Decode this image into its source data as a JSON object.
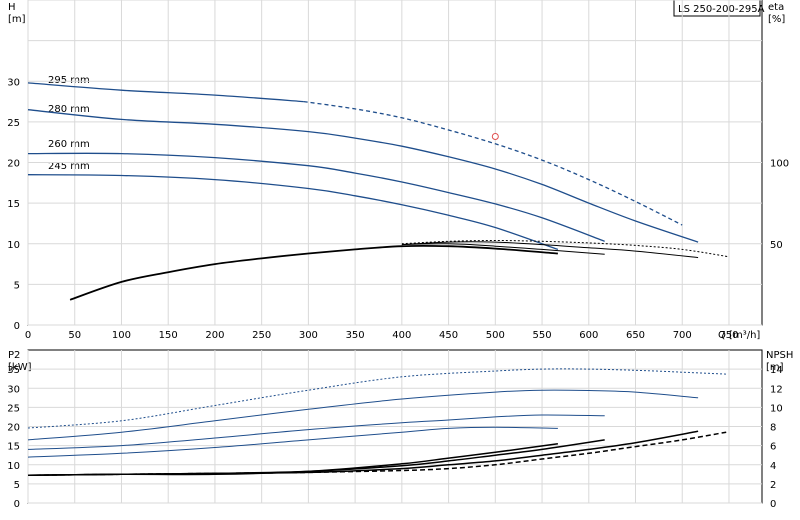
{
  "chart_data": [
    {
      "type": "line",
      "panel": "head-efficiency",
      "title": "LS 250-200-295A",
      "xlabel": "Q [m³/h]",
      "ylabel_left": {
        "name": "H",
        "unit": "[m]"
      },
      "ylabel_right": {
        "name": "eta",
        "unit": "[%]"
      },
      "xlim": [
        0,
        750
      ],
      "ylim": [
        0,
        40
      ],
      "y2lim": [
        0,
        200
      ],
      "grid": true,
      "x_ticks": [
        "0",
        "50",
        "100",
        "150",
        "200",
        "250",
        "300",
        "350",
        "400",
        "450",
        "500",
        "550",
        "600",
        "650",
        "700",
        "750"
      ],
      "y_ticks": [
        "0",
        "5",
        "10",
        "15",
        "20",
        "25",
        "30"
      ],
      "y2_ticks": [
        "50",
        "100"
      ],
      "head_series": [
        {
          "name": "295 mm",
          "color": "#1f4e8c",
          "dashed_from": 295,
          "x": [
            0,
            100,
            200,
            295,
            350,
            400,
            450,
            500,
            550,
            600,
            650,
            700
          ],
          "y": [
            29.8,
            28.9,
            28.3,
            27.5,
            26.6,
            25.5,
            24.0,
            22.3,
            20.3,
            17.9,
            15.2,
            12.3
          ]
        },
        {
          "name": "280 mm",
          "color": "#1f4e8c",
          "x": [
            0,
            100,
            200,
            300,
            350,
            400,
            450,
            500,
            550,
            600,
            650,
            717
          ],
          "y": [
            26.5,
            25.3,
            24.7,
            23.8,
            23.0,
            22.0,
            20.7,
            19.2,
            17.3,
            15.0,
            12.8,
            10.2
          ]
        },
        {
          "name": "260 mm",
          "color": "#1f4e8c",
          "x": [
            0,
            100,
            200,
            300,
            350,
            400,
            450,
            500,
            550,
            617
          ],
          "y": [
            21.1,
            21.1,
            20.6,
            19.6,
            18.7,
            17.6,
            16.3,
            14.9,
            13.2,
            10.3
          ]
        },
        {
          "name": "245 mm",
          "color": "#1f4e8c",
          "x": [
            0,
            100,
            200,
            300,
            350,
            400,
            450,
            500,
            567
          ],
          "y": [
            18.5,
            18.4,
            17.9,
            16.8,
            15.9,
            14.8,
            13.5,
            12.0,
            9.3
          ]
        }
      ],
      "efficiency_series": [
        {
          "style": "solid",
          "x": [
            45,
            100,
            150,
            200,
            250,
            300,
            350,
            400,
            450,
            500,
            567
          ],
          "y": [
            15.5,
            26.5,
            32.5,
            37.5,
            41.0,
            44.0,
            46.5,
            48.5,
            48.5,
            47.0,
            44.0
          ]
        },
        {
          "style": "solid",
          "x": [
            400,
            450,
            500,
            550,
            617
          ],
          "y": [
            49.5,
            50.0,
            48.5,
            46.5,
            43.5
          ]
        },
        {
          "style": "solid",
          "x": [
            400,
            450,
            500,
            550,
            600,
            650,
            717
          ],
          "y": [
            49.5,
            51.0,
            51.0,
            49.5,
            47.5,
            45.5,
            41.5
          ]
        },
        {
          "style": "dotted",
          "x": [
            400,
            450,
            500,
            550,
            600,
            650,
            700,
            750
          ],
          "y": [
            50.0,
            51.5,
            52.0,
            51.5,
            50.5,
            49.0,
            46.5,
            42.0
          ]
        }
      ],
      "marker": {
        "x": 500,
        "y": 23.2,
        "color": "#e05050"
      }
    },
    {
      "type": "line",
      "panel": "power-npsh",
      "ylabel_left": {
        "name": "P2",
        "unit": "[kW]"
      },
      "ylabel_right": {
        "name": "NPSH",
        "unit": "[m]"
      },
      "xlim": [
        0,
        750
      ],
      "ylim": [
        0,
        40
      ],
      "y2lim": [
        0,
        16
      ],
      "grid": true,
      "y_ticks": [
        "0",
        "5",
        "10",
        "15",
        "20",
        "25",
        "30",
        "35"
      ],
      "y2_ticks": [
        "0",
        "2",
        "4",
        "6",
        "8",
        "10",
        "12",
        "14"
      ],
      "power_series": [
        {
          "style": "dotted",
          "x": [
            0,
            100,
            200,
            300,
            400,
            500,
            550,
            600,
            650,
            700,
            747
          ],
          "y": [
            19.6,
            21.5,
            25.5,
            29.5,
            33.0,
            34.5,
            35.0,
            35.0,
            34.7,
            34.2,
            33.7
          ]
        },
        {
          "style": "solid",
          "x": [
            0,
            100,
            200,
            300,
            400,
            500,
            550,
            600,
            650,
            717
          ],
          "y": [
            16.5,
            18.5,
            21.5,
            24.5,
            27.2,
            29.0,
            29.5,
            29.4,
            29.0,
            27.5
          ]
        },
        {
          "style": "solid",
          "x": [
            0,
            100,
            200,
            300,
            400,
            450,
            500,
            550,
            617
          ],
          "y": [
            14.0,
            15.0,
            17.0,
            19.2,
            21.0,
            21.7,
            22.5,
            23.0,
            22.8
          ]
        },
        {
          "style": "solid",
          "x": [
            0,
            100,
            200,
            300,
            400,
            450,
            500,
            567
          ],
          "y": [
            12.0,
            13.0,
            14.5,
            16.5,
            18.5,
            19.5,
            19.8,
            19.5
          ]
        }
      ],
      "npsh_series": [
        {
          "style": "solid",
          "x": [
            0,
            100,
            200,
            300,
            400,
            450,
            500,
            567
          ],
          "y": [
            2.9,
            3.0,
            3.0,
            3.3,
            4.1,
            4.7,
            5.3,
            6.2
          ]
        },
        {
          "style": "solid",
          "x": [
            0,
            100,
            200,
            300,
            400,
            450,
            500,
            550,
            617
          ],
          "y": [
            2.9,
            3.0,
            3.1,
            3.3,
            3.9,
            4.4,
            5.0,
            5.6,
            6.6
          ]
        },
        {
          "style": "solid",
          "x": [
            0,
            100,
            200,
            300,
            400,
            450,
            500,
            550,
            600,
            650,
            717
          ],
          "y": [
            2.9,
            3.0,
            3.1,
            3.2,
            3.6,
            4.0,
            4.4,
            5.0,
            5.6,
            6.3,
            7.5
          ]
        },
        {
          "style": "dashed",
          "x": [
            0,
            100,
            200,
            300,
            400,
            450,
            500,
            550,
            600,
            650,
            700,
            747
          ],
          "y": [
            2.9,
            3.0,
            3.1,
            3.2,
            3.4,
            3.6,
            4.0,
            4.6,
            5.2,
            5.9,
            6.6,
            7.4
          ]
        }
      ]
    }
  ]
}
